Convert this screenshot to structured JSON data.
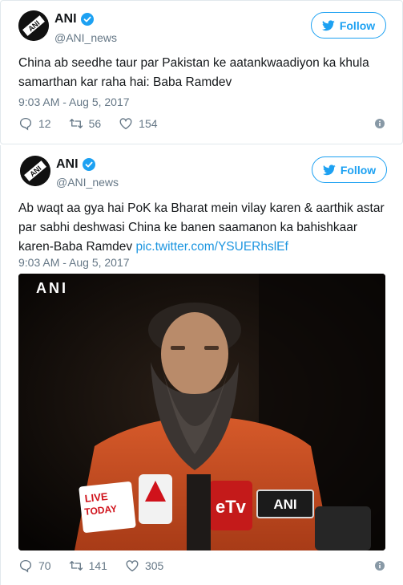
{
  "tweets": [
    {
      "author": {
        "name": "ANI",
        "handle": "@ANI_news"
      },
      "follow_label": "Follow",
      "text": "China ab seedhe taur par Pakistan ke aatankwaadiyon ka khula samarthan kar raha hai: Baba Ramdev",
      "timestamp": "9:03 AM - Aug 5, 2017",
      "counts": {
        "replies": "12",
        "retweets": "56",
        "likes": "154"
      }
    },
    {
      "author": {
        "name": "ANI",
        "handle": "@ANI_news"
      },
      "follow_label": "Follow",
      "text": "Ab waqt aa gya hai PoK ka Bharat mein vilay karen & aarthik astar par sabhi deshwasi China ke banen saamanon ka bahishkaar karen-Baba Ramdev ",
      "link": "pic.twitter.com/YSUERhslEf",
      "timestamp": "9:03 AM - Aug 5, 2017",
      "media": {
        "watermark": "ANI",
        "mics": [
          "LIVE TODAY",
          "ETV",
          "ANI"
        ]
      },
      "counts": {
        "replies": "70",
        "retweets": "141",
        "likes": "305"
      }
    }
  ],
  "colors": {
    "accent": "#1da1f2",
    "link": "#1b95e0",
    "muted": "#657786",
    "border": "#e1e8ed"
  }
}
